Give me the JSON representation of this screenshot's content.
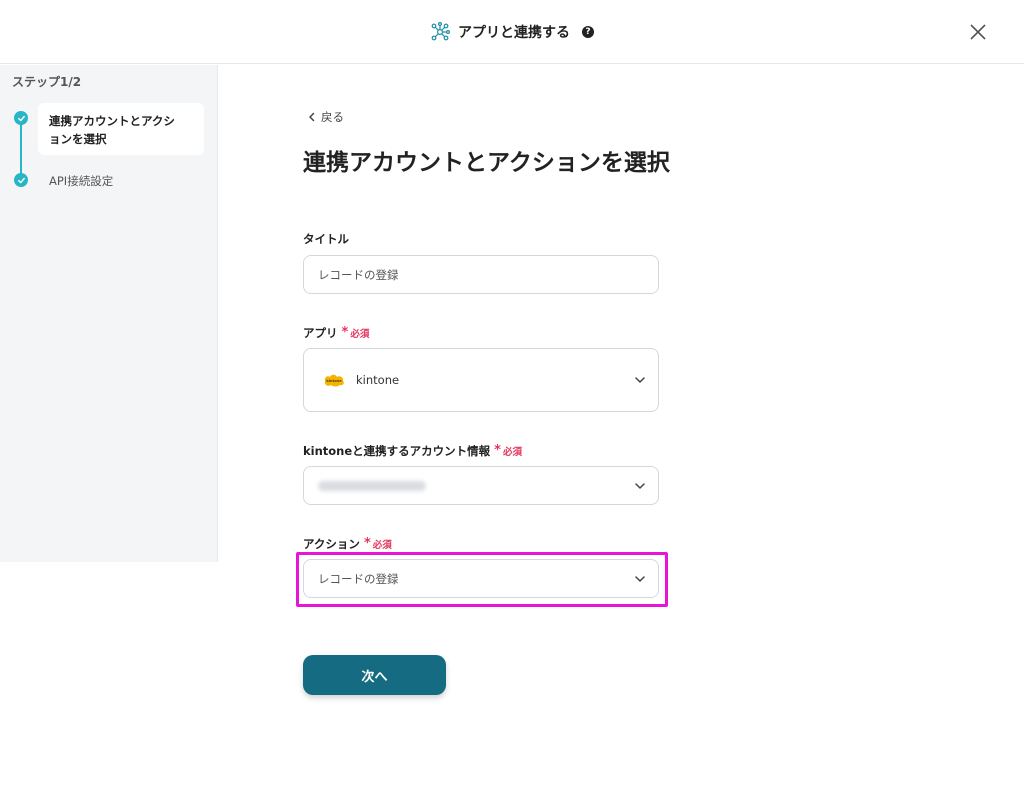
{
  "header": {
    "title": "アプリと連携する",
    "help_icon": "?",
    "close_icon": "close-icon"
  },
  "sidebar": {
    "step_heading": "ステップ1/2",
    "steps": [
      {
        "label": "連携アカウントとアクションを選択",
        "line1": "連携アカウントとアクシ",
        "line2": "ョンを選択",
        "active": true
      },
      {
        "label": "API接続設定",
        "active": false
      }
    ],
    "accent": "#26b6c6"
  },
  "main": {
    "back_label": "戻る",
    "page_title": "連携アカウントとアクションを選択",
    "fields": {
      "title": {
        "label": "タイトル",
        "value": "レコードの登録"
      },
      "app": {
        "label": "アプリ",
        "required": "必須",
        "value": "kintone",
        "logo_text": "kintone"
      },
      "account": {
        "label": "kintoneと連携するアカウント情報",
        "required": "必須",
        "value": ""
      },
      "action": {
        "label": "アクション",
        "required": "必須",
        "value": "レコードの登録"
      }
    },
    "next_label": "次へ"
  },
  "colors": {
    "primary_button": "#146b82",
    "required": "#e5355d",
    "highlight": "#e815d8"
  }
}
